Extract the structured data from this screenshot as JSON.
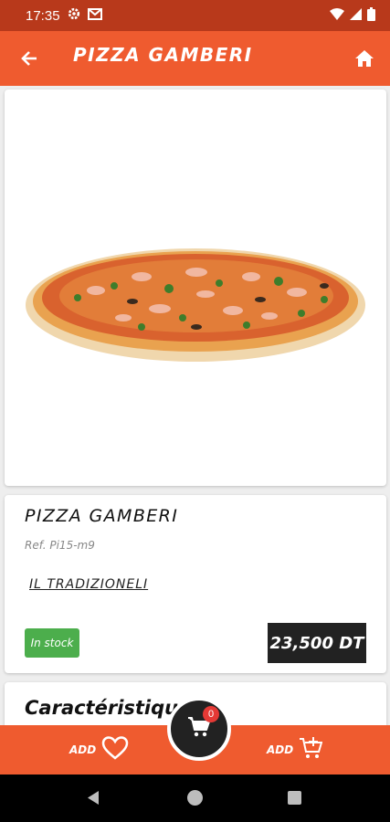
{
  "status_bar": {
    "time": "17:35",
    "icons": [
      "gear-icon",
      "gmail-icon",
      "wifi-icon",
      "signal-icon",
      "battery-icon"
    ]
  },
  "app_bar": {
    "title": "PIZZA GAMBERI",
    "back_icon": "arrow-left-icon",
    "home_icon": "home-icon"
  },
  "product": {
    "name": "PIZZA GAMBERI",
    "ref": "Ref. Pi15-m9",
    "category": "IL TRADIZIONELI",
    "stock": "In stock",
    "price": "23,500 DT",
    "image": "pizza-gamberi-photo"
  },
  "spec": {
    "title": "Caractéristique"
  },
  "bottom_bar": {
    "add_fav_label": "ADD",
    "add_cart_label": "ADD",
    "cart_count": "0"
  },
  "colors": {
    "primary": "#ef5b2f",
    "status_bar": "#b8391b",
    "stock_badge": "#4cae4c",
    "price_bg": "#222222",
    "cart_badge": "#e53935"
  }
}
